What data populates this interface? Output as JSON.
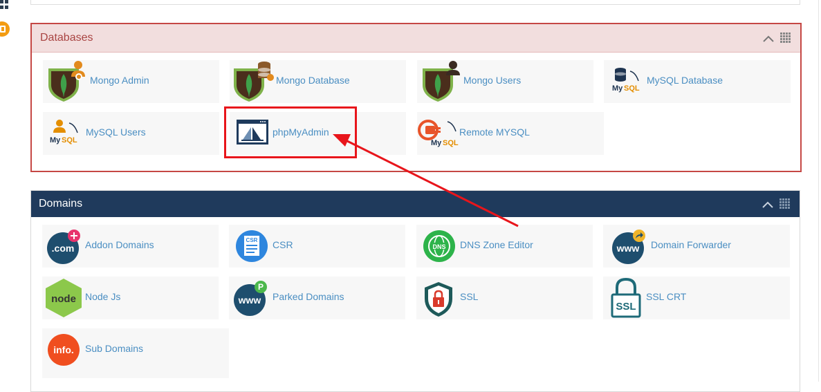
{
  "databases": {
    "title": "Databases",
    "items": [
      {
        "label": "Mongo Admin",
        "icon": "mongo-admin-icon"
      },
      {
        "label": "Mongo Database",
        "icon": "mongo-database-icon"
      },
      {
        "label": "Mongo Users",
        "icon": "mongo-users-icon"
      },
      {
        "label": "MySQL Database",
        "icon": "mysql-database-icon"
      },
      {
        "label": "MySQL Users",
        "icon": "mysql-users-icon"
      },
      {
        "label": "phpMyAdmin",
        "icon": "phpmyadmin-icon"
      },
      {
        "label": "Remote MYSQL",
        "icon": "remote-mysql-icon"
      }
    ]
  },
  "domains": {
    "title": "Domains",
    "items": [
      {
        "label": "Addon Domains",
        "icon": "addon-domains-icon"
      },
      {
        "label": "CSR",
        "icon": "csr-icon"
      },
      {
        "label": "DNS Zone Editor",
        "icon": "dns-zone-editor-icon"
      },
      {
        "label": "Domain Forwarder",
        "icon": "domain-forwarder-icon"
      },
      {
        "label": "Node Js",
        "icon": "node-js-icon"
      },
      {
        "label": "Parked Domains",
        "icon": "parked-domains-icon"
      },
      {
        "label": "SSL",
        "icon": "ssl-icon"
      },
      {
        "label": "SSL CRT",
        "icon": "ssl-crt-icon"
      },
      {
        "label": "Sub Domains",
        "icon": "sub-domains-icon"
      }
    ]
  },
  "icon_text": {
    "com": ".com",
    "csr": "CSR",
    "dns": "DNS",
    "www": "www",
    "node": "node",
    "ssl": "SSL",
    "info": "info.",
    "mysql": "MySQL"
  },
  "colors": {
    "databases_border": "#c54744",
    "databases_header_bg": "#f2dede",
    "databases_title": "#a94442",
    "domains_header_bg": "#1f3a5c",
    "link": "#4a8ec2",
    "annotation_red": "#e8151b"
  }
}
